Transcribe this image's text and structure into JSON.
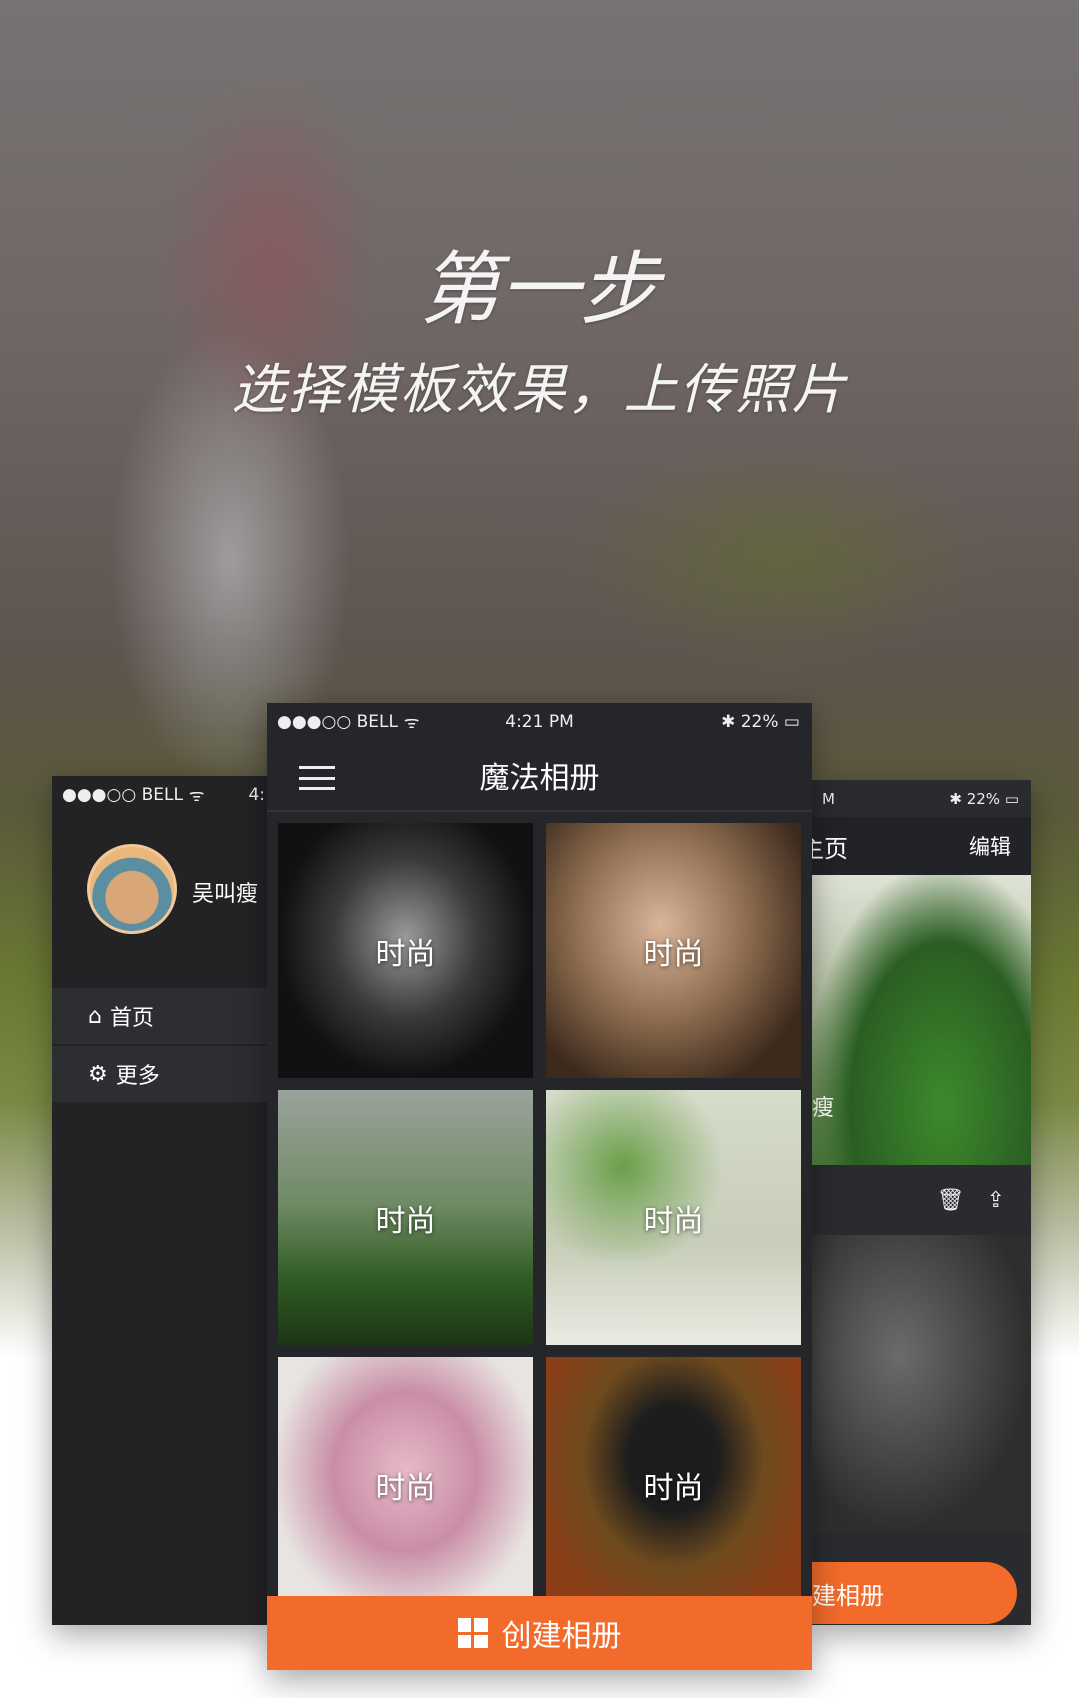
{
  "headline": {
    "title": "第一步",
    "subtitle": "选择模板效果，上传照片"
  },
  "left_phone": {
    "carrier": "●●●○○ BELL",
    "time_partial": "4:",
    "user_name": "吴叫瘦",
    "menu": [
      {
        "icon": "home-icon",
        "label": "首页"
      },
      {
        "icon": "gear-icon",
        "label": "更多"
      }
    ]
  },
  "center_phone": {
    "carrier": "●●●○○ BELL",
    "time": "4:21 PM",
    "battery": "22%",
    "title": "魔法相册",
    "tiles": [
      {
        "label": "时尚"
      },
      {
        "label": "时尚"
      },
      {
        "label": "时尚"
      },
      {
        "label": "时尚"
      },
      {
        "label": "时尚"
      },
      {
        "label": "时尚"
      }
    ],
    "create_button": "创建相册"
  },
  "right_phone": {
    "time_partial": "M",
    "battery": "22%",
    "title_partial": "主页",
    "edit": "编辑",
    "name_partial": "瘦",
    "create_partial": "建相册"
  },
  "colors": {
    "accent": "#f26b2a",
    "phone_bg": "#25262a"
  }
}
